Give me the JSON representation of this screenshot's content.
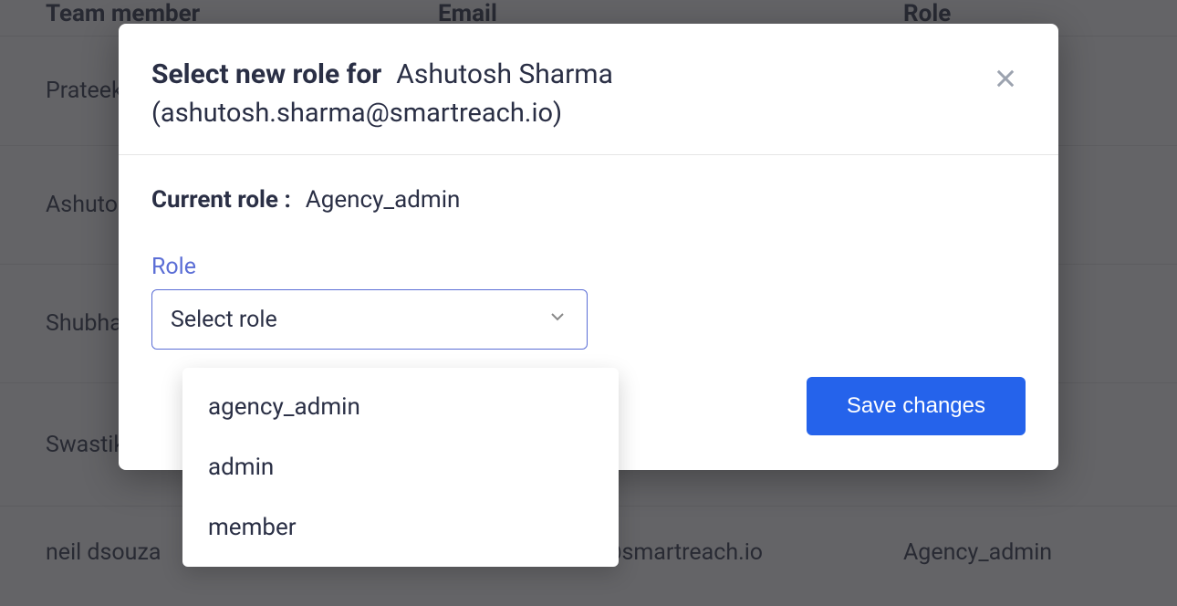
{
  "table": {
    "headers": {
      "name": "Team member",
      "email": "Email",
      "role": "Role"
    },
    "rows": [
      {
        "name": "Prateek Bh",
        "email": "",
        "role": ""
      },
      {
        "name": "Ashutosh",
        "email": "",
        "role": ""
      },
      {
        "name": "Shubham",
        "email": "",
        "role": ""
      },
      {
        "name": "Swastik P",
        "email": "",
        "role": ""
      },
      {
        "name": "neil dsouza",
        "email": "neil+testaadmin@smartreach.io",
        "role": "Agency_admin"
      }
    ]
  },
  "modal": {
    "title_prefix": "Select new role for",
    "user_name": "Ashutosh Sharma",
    "user_email_line": "(ashutosh.sharma@smartreach.io)",
    "current_role_label": "Current role :",
    "current_role_value": "Agency_admin",
    "role_field_label": "Role",
    "role_select_placeholder": "Select role",
    "save_label": "Save changes",
    "dropdown_options": {
      "0": "agency_admin",
      "1": "admin",
      "2": "member"
    }
  }
}
